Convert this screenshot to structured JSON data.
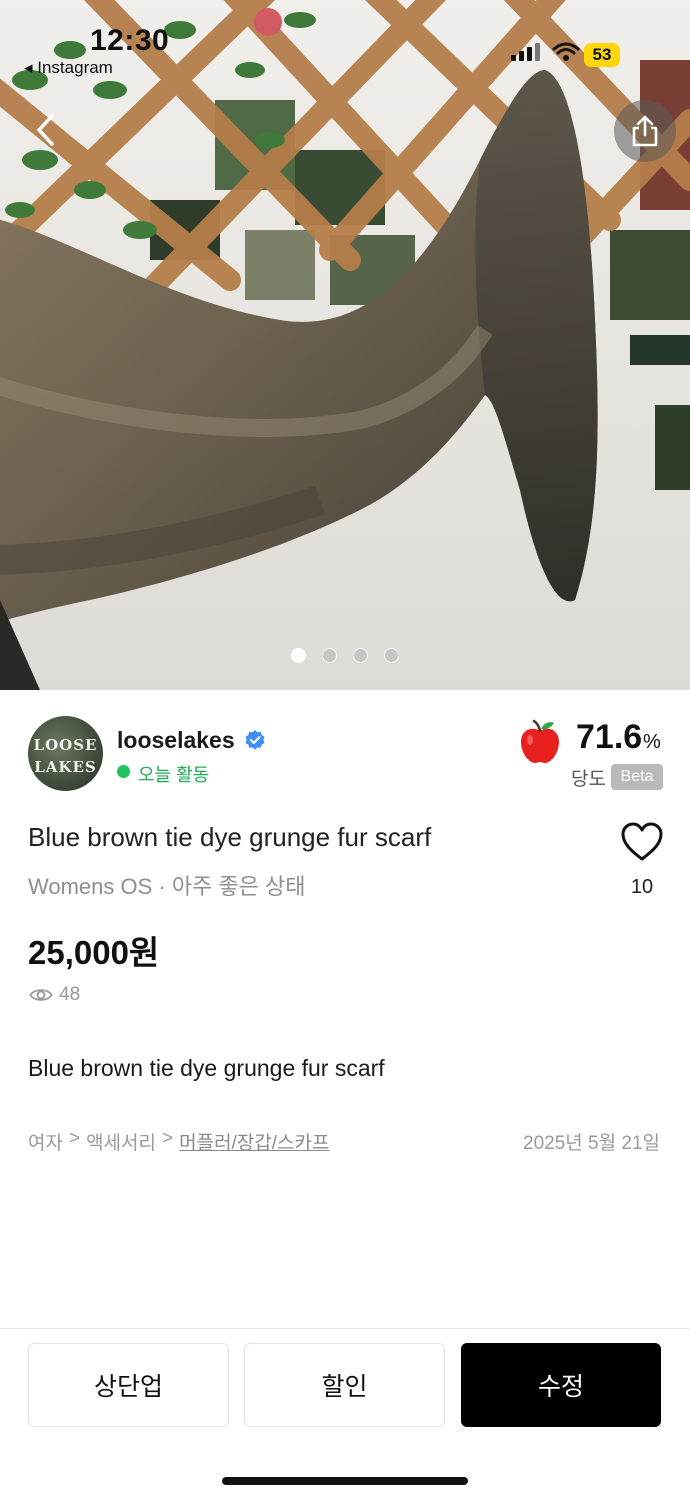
{
  "status_bar": {
    "time": "12:30",
    "back_app": "◂ Instagram",
    "battery": "53"
  },
  "hero": {
    "image_count": 4,
    "active_index": 0
  },
  "seller": {
    "avatar_text_line1": "LOOSE",
    "avatar_text_line2": "LAKES",
    "name": "looselakes",
    "verified_icon": "verified-badge-icon",
    "activity": "오늘 활동",
    "score": "71.6",
    "score_unit": "%",
    "score_label": "당도",
    "score_badge": "Beta"
  },
  "product": {
    "title": "Blue brown tie dye grunge fur scarf",
    "subtitle": "Womens OS · 아주 좋은 상태",
    "likes": "10",
    "price": "25,000원",
    "views": "48",
    "description": "Blue brown tie dye grunge fur scarf"
  },
  "breadcrumb": {
    "level1": "여자",
    "level2": "액세서리",
    "level3": "머플러/장갑/스카프",
    "separator": ">"
  },
  "posted_date": "2025년 5월 21일",
  "actions": {
    "bump_label": "상단업",
    "discount_label": "할인",
    "edit_label": "수정"
  },
  "colors": {
    "active_green": "#20c45e",
    "verified_blue": "#3d8ef7",
    "primary_button": "#000000"
  }
}
